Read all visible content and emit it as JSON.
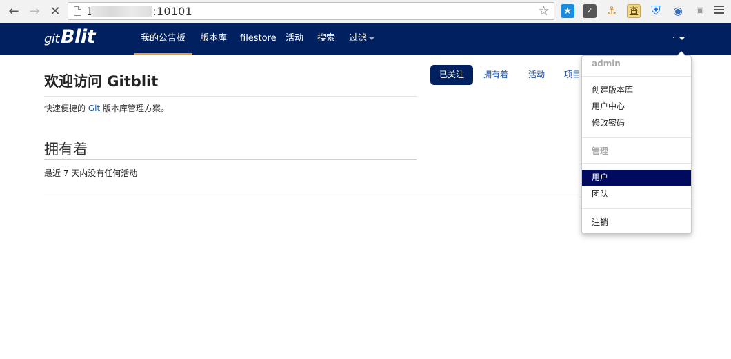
{
  "browser": {
    "url_start": "1",
    "url_end": ":10101",
    "back_icon": "arrow-left-icon",
    "forward_icon": "arrow-right-icon",
    "stop_icon": "close-icon",
    "bookmark_icon": "star-icon",
    "extension_icons": [
      "bookmark-star-extension-icon",
      "pocket-icon",
      "key-extension-icon",
      "dictionary-extension-icon",
      "shield-extension-icon",
      "translate-extension-icon",
      "sitemap-extension-icon"
    ],
    "ext_glyph_dictionary": "査"
  },
  "navbar": {
    "logo_prefix": "git",
    "logo_text": "Blit",
    "items": [
      {
        "label": "我的公告板",
        "active": true
      },
      {
        "label": "版本库"
      },
      {
        "label": "filestore"
      },
      {
        "label": "活动"
      },
      {
        "label": "搜索"
      },
      {
        "label": "过滤"
      }
    ],
    "user_toggle": "·"
  },
  "main": {
    "title": "欢迎访问 Gitblit",
    "desc_before": "快速便捷的 ",
    "desc_link": "Git",
    "desc_after": " 版本库管理方案。",
    "section_title": "拥有着",
    "activity_text": "最近 7 天内没有任何活动"
  },
  "tabs": [
    {
      "label": "已关注",
      "active": true
    },
    {
      "label": "拥有着"
    },
    {
      "label": "活动"
    },
    {
      "label": "项目"
    }
  ],
  "dropdown": {
    "header_user": "admin",
    "items_user": [
      "创建版本库",
      "用户中心",
      "修改密码"
    ],
    "header_admin": "管理",
    "items_admin": [
      "用户",
      "团队"
    ],
    "logout": "注销"
  },
  "colors": {
    "navbar_bg": "#002060",
    "active_underline": "#f29a2e",
    "menu_highlight": "#000a5e"
  }
}
